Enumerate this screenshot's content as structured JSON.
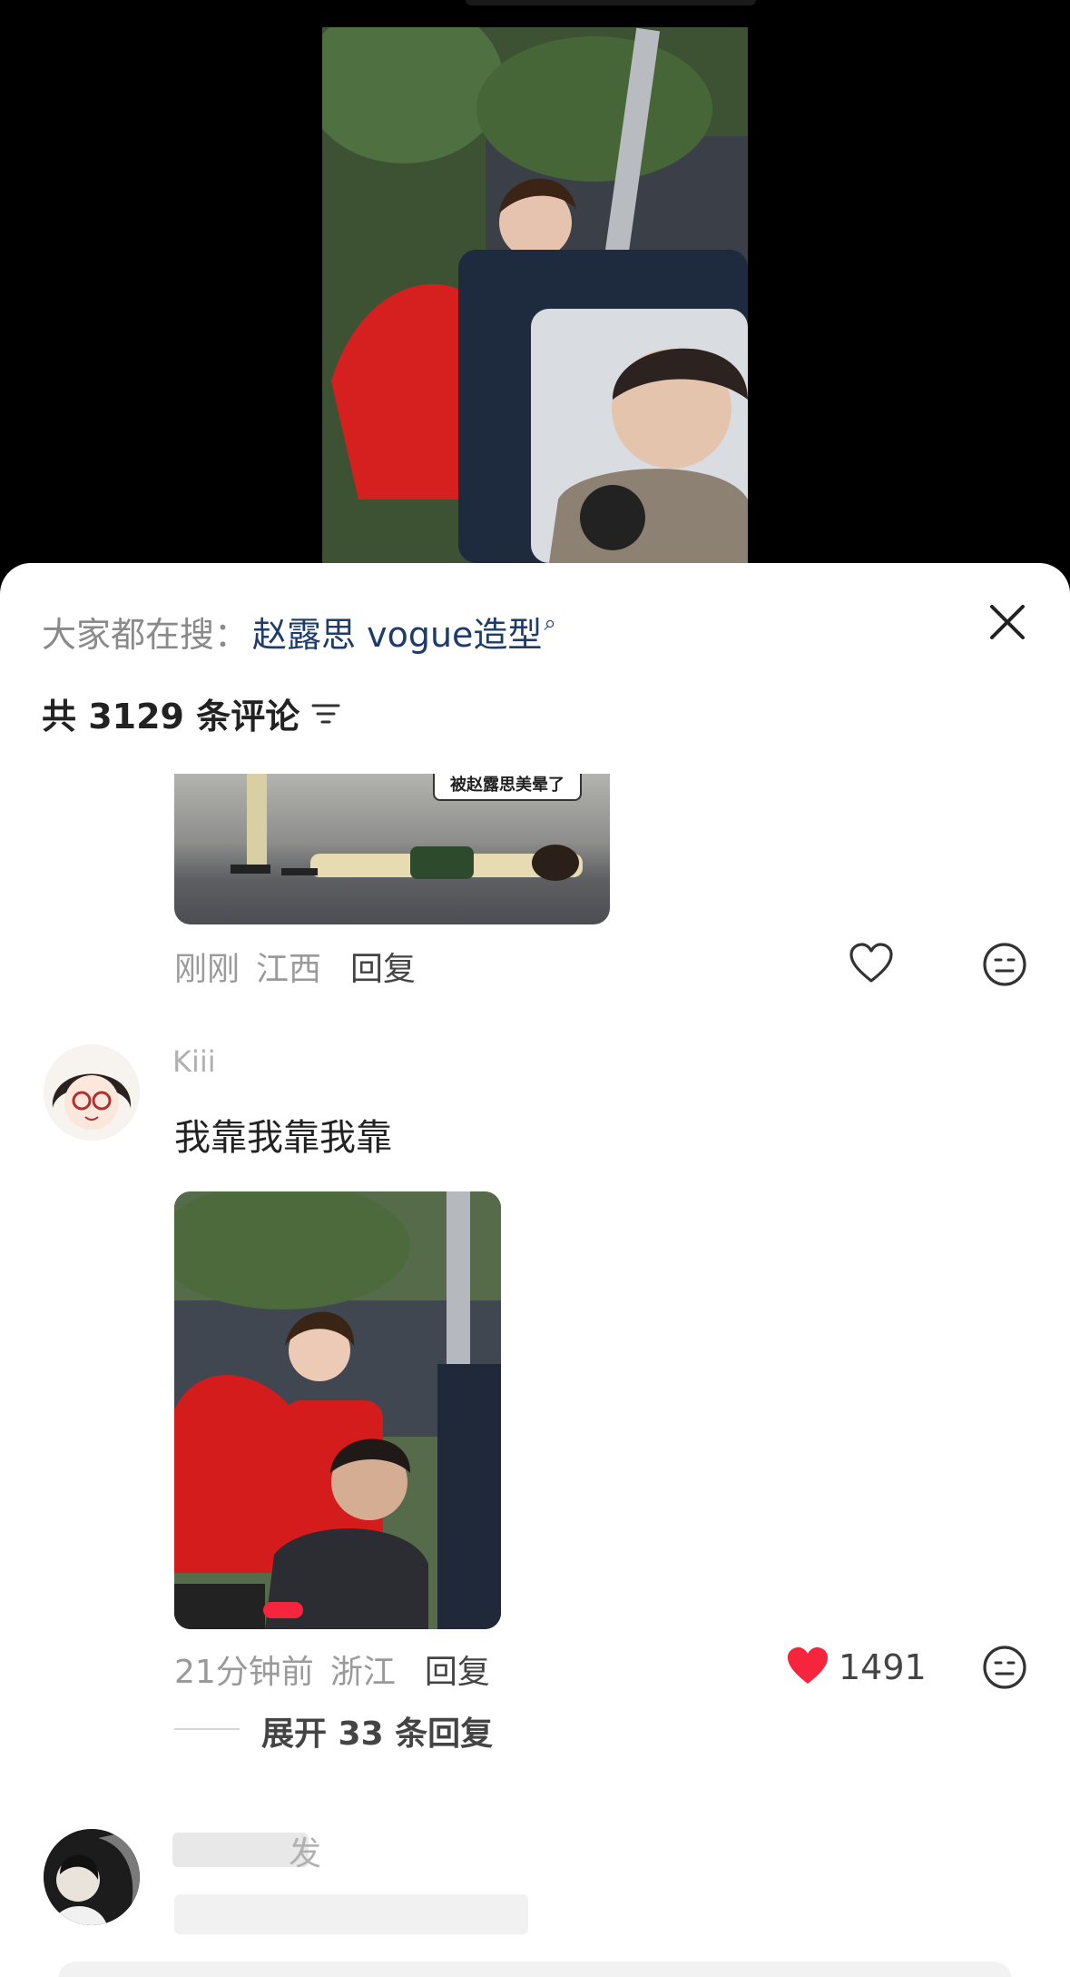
{
  "hot_search": {
    "prefix": "大家都在搜：",
    "keyword": "赵露思 vogue造型",
    "search_glyph": "⌕"
  },
  "comments_header": {
    "title": "共 3129 条评论"
  },
  "comments": [
    {
      "sticker_text": "被赵露思美晕了",
      "time": "刚刚",
      "location": "江西",
      "reply_label": "回复"
    },
    {
      "username": "Kiii",
      "text": "我靠我靠我靠",
      "time": "21分钟前",
      "location": "浙江",
      "reply_label": "回复",
      "likes": "1491",
      "liked": true,
      "expand_label": "展开 33 条回复"
    },
    {
      "username": "发"
    }
  ],
  "colors": {
    "like_red": "#f5253d",
    "keyword_blue": "#1d3b6b"
  },
  "icons": [
    "close-icon",
    "sort-icon",
    "heart-outline-icon",
    "heart-filled-icon",
    "emoji-icon"
  ]
}
